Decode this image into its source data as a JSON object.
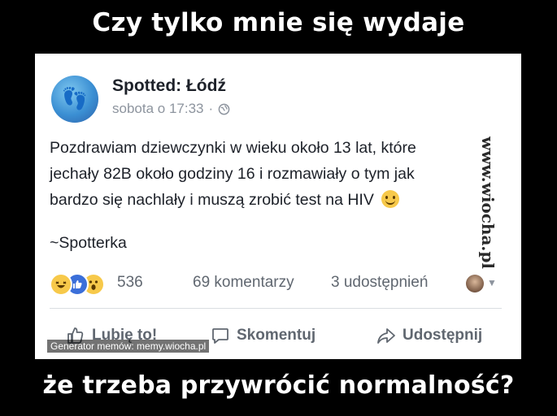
{
  "meme": {
    "top_text": "Czy tylko mnie się wydaje",
    "bottom_text": "że trzeba przywrócić normalność?"
  },
  "post": {
    "page_name": "Spotted: Łódź",
    "timestamp": "sobota o 17:33",
    "separator": "·",
    "privacy_icon": "globe-icon",
    "text_lines": [
      "Pozdrawiam dziewczynki w wieku około 13 lat, które",
      "jechały 82B około godziny 16 i rozmawiały o tym jak",
      "bardzo się nachlały i muszą zrobić test na HIV"
    ],
    "signature": "~Spotterka"
  },
  "stats": {
    "reactions": [
      "haha",
      "like",
      "wow"
    ],
    "reaction_count": "536",
    "comments": "69 komentarzy",
    "shares": "3 udostępnień"
  },
  "actions": {
    "like": "Lubię to!",
    "comment": "Skomentuj",
    "share": "Udostępnij"
  },
  "watermarks": {
    "generator": "Generator memów: memy.wiocha.pl",
    "side": "www.wiocha.pl"
  },
  "colors": {
    "background": "#000000",
    "card": "#ffffff",
    "text": "#1d2129",
    "secondary": "#8d949e",
    "like_blue": "#3b6fd9",
    "emoji_yellow": "#f7c94a"
  }
}
